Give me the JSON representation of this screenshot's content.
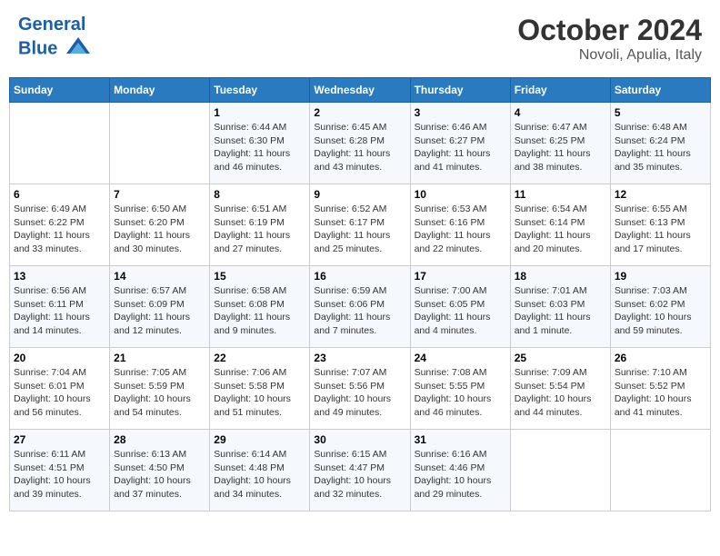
{
  "header": {
    "logo": "GeneralBlue",
    "title": "October 2024",
    "subtitle": "Novoli, Apulia, Italy"
  },
  "weekdays": [
    "Sunday",
    "Monday",
    "Tuesday",
    "Wednesday",
    "Thursday",
    "Friday",
    "Saturday"
  ],
  "weeks": [
    [
      {
        "day": null,
        "info": null
      },
      {
        "day": null,
        "info": null
      },
      {
        "day": "1",
        "info": "Sunrise: 6:44 AM\nSunset: 6:30 PM\nDaylight: 11 hours and 46 minutes."
      },
      {
        "day": "2",
        "info": "Sunrise: 6:45 AM\nSunset: 6:28 PM\nDaylight: 11 hours and 43 minutes."
      },
      {
        "day": "3",
        "info": "Sunrise: 6:46 AM\nSunset: 6:27 PM\nDaylight: 11 hours and 41 minutes."
      },
      {
        "day": "4",
        "info": "Sunrise: 6:47 AM\nSunset: 6:25 PM\nDaylight: 11 hours and 38 minutes."
      },
      {
        "day": "5",
        "info": "Sunrise: 6:48 AM\nSunset: 6:24 PM\nDaylight: 11 hours and 35 minutes."
      }
    ],
    [
      {
        "day": "6",
        "info": "Sunrise: 6:49 AM\nSunset: 6:22 PM\nDaylight: 11 hours and 33 minutes."
      },
      {
        "day": "7",
        "info": "Sunrise: 6:50 AM\nSunset: 6:20 PM\nDaylight: 11 hours and 30 minutes."
      },
      {
        "day": "8",
        "info": "Sunrise: 6:51 AM\nSunset: 6:19 PM\nDaylight: 11 hours and 27 minutes."
      },
      {
        "day": "9",
        "info": "Sunrise: 6:52 AM\nSunset: 6:17 PM\nDaylight: 11 hours and 25 minutes."
      },
      {
        "day": "10",
        "info": "Sunrise: 6:53 AM\nSunset: 6:16 PM\nDaylight: 11 hours and 22 minutes."
      },
      {
        "day": "11",
        "info": "Sunrise: 6:54 AM\nSunset: 6:14 PM\nDaylight: 11 hours and 20 minutes."
      },
      {
        "day": "12",
        "info": "Sunrise: 6:55 AM\nSunset: 6:13 PM\nDaylight: 11 hours and 17 minutes."
      }
    ],
    [
      {
        "day": "13",
        "info": "Sunrise: 6:56 AM\nSunset: 6:11 PM\nDaylight: 11 hours and 14 minutes."
      },
      {
        "day": "14",
        "info": "Sunrise: 6:57 AM\nSunset: 6:09 PM\nDaylight: 11 hours and 12 minutes."
      },
      {
        "day": "15",
        "info": "Sunrise: 6:58 AM\nSunset: 6:08 PM\nDaylight: 11 hours and 9 minutes."
      },
      {
        "day": "16",
        "info": "Sunrise: 6:59 AM\nSunset: 6:06 PM\nDaylight: 11 hours and 7 minutes."
      },
      {
        "day": "17",
        "info": "Sunrise: 7:00 AM\nSunset: 6:05 PM\nDaylight: 11 hours and 4 minutes."
      },
      {
        "day": "18",
        "info": "Sunrise: 7:01 AM\nSunset: 6:03 PM\nDaylight: 11 hours and 1 minute."
      },
      {
        "day": "19",
        "info": "Sunrise: 7:03 AM\nSunset: 6:02 PM\nDaylight: 10 hours and 59 minutes."
      }
    ],
    [
      {
        "day": "20",
        "info": "Sunrise: 7:04 AM\nSunset: 6:01 PM\nDaylight: 10 hours and 56 minutes."
      },
      {
        "day": "21",
        "info": "Sunrise: 7:05 AM\nSunset: 5:59 PM\nDaylight: 10 hours and 54 minutes."
      },
      {
        "day": "22",
        "info": "Sunrise: 7:06 AM\nSunset: 5:58 PM\nDaylight: 10 hours and 51 minutes."
      },
      {
        "day": "23",
        "info": "Sunrise: 7:07 AM\nSunset: 5:56 PM\nDaylight: 10 hours and 49 minutes."
      },
      {
        "day": "24",
        "info": "Sunrise: 7:08 AM\nSunset: 5:55 PM\nDaylight: 10 hours and 46 minutes."
      },
      {
        "day": "25",
        "info": "Sunrise: 7:09 AM\nSunset: 5:54 PM\nDaylight: 10 hours and 44 minutes."
      },
      {
        "day": "26",
        "info": "Sunrise: 7:10 AM\nSunset: 5:52 PM\nDaylight: 10 hours and 41 minutes."
      }
    ],
    [
      {
        "day": "27",
        "info": "Sunrise: 6:11 AM\nSunset: 4:51 PM\nDaylight: 10 hours and 39 minutes."
      },
      {
        "day": "28",
        "info": "Sunrise: 6:13 AM\nSunset: 4:50 PM\nDaylight: 10 hours and 37 minutes."
      },
      {
        "day": "29",
        "info": "Sunrise: 6:14 AM\nSunset: 4:48 PM\nDaylight: 10 hours and 34 minutes."
      },
      {
        "day": "30",
        "info": "Sunrise: 6:15 AM\nSunset: 4:47 PM\nDaylight: 10 hours and 32 minutes."
      },
      {
        "day": "31",
        "info": "Sunrise: 6:16 AM\nSunset: 4:46 PM\nDaylight: 10 hours and 29 minutes."
      },
      {
        "day": null,
        "info": null
      },
      {
        "day": null,
        "info": null
      }
    ]
  ]
}
